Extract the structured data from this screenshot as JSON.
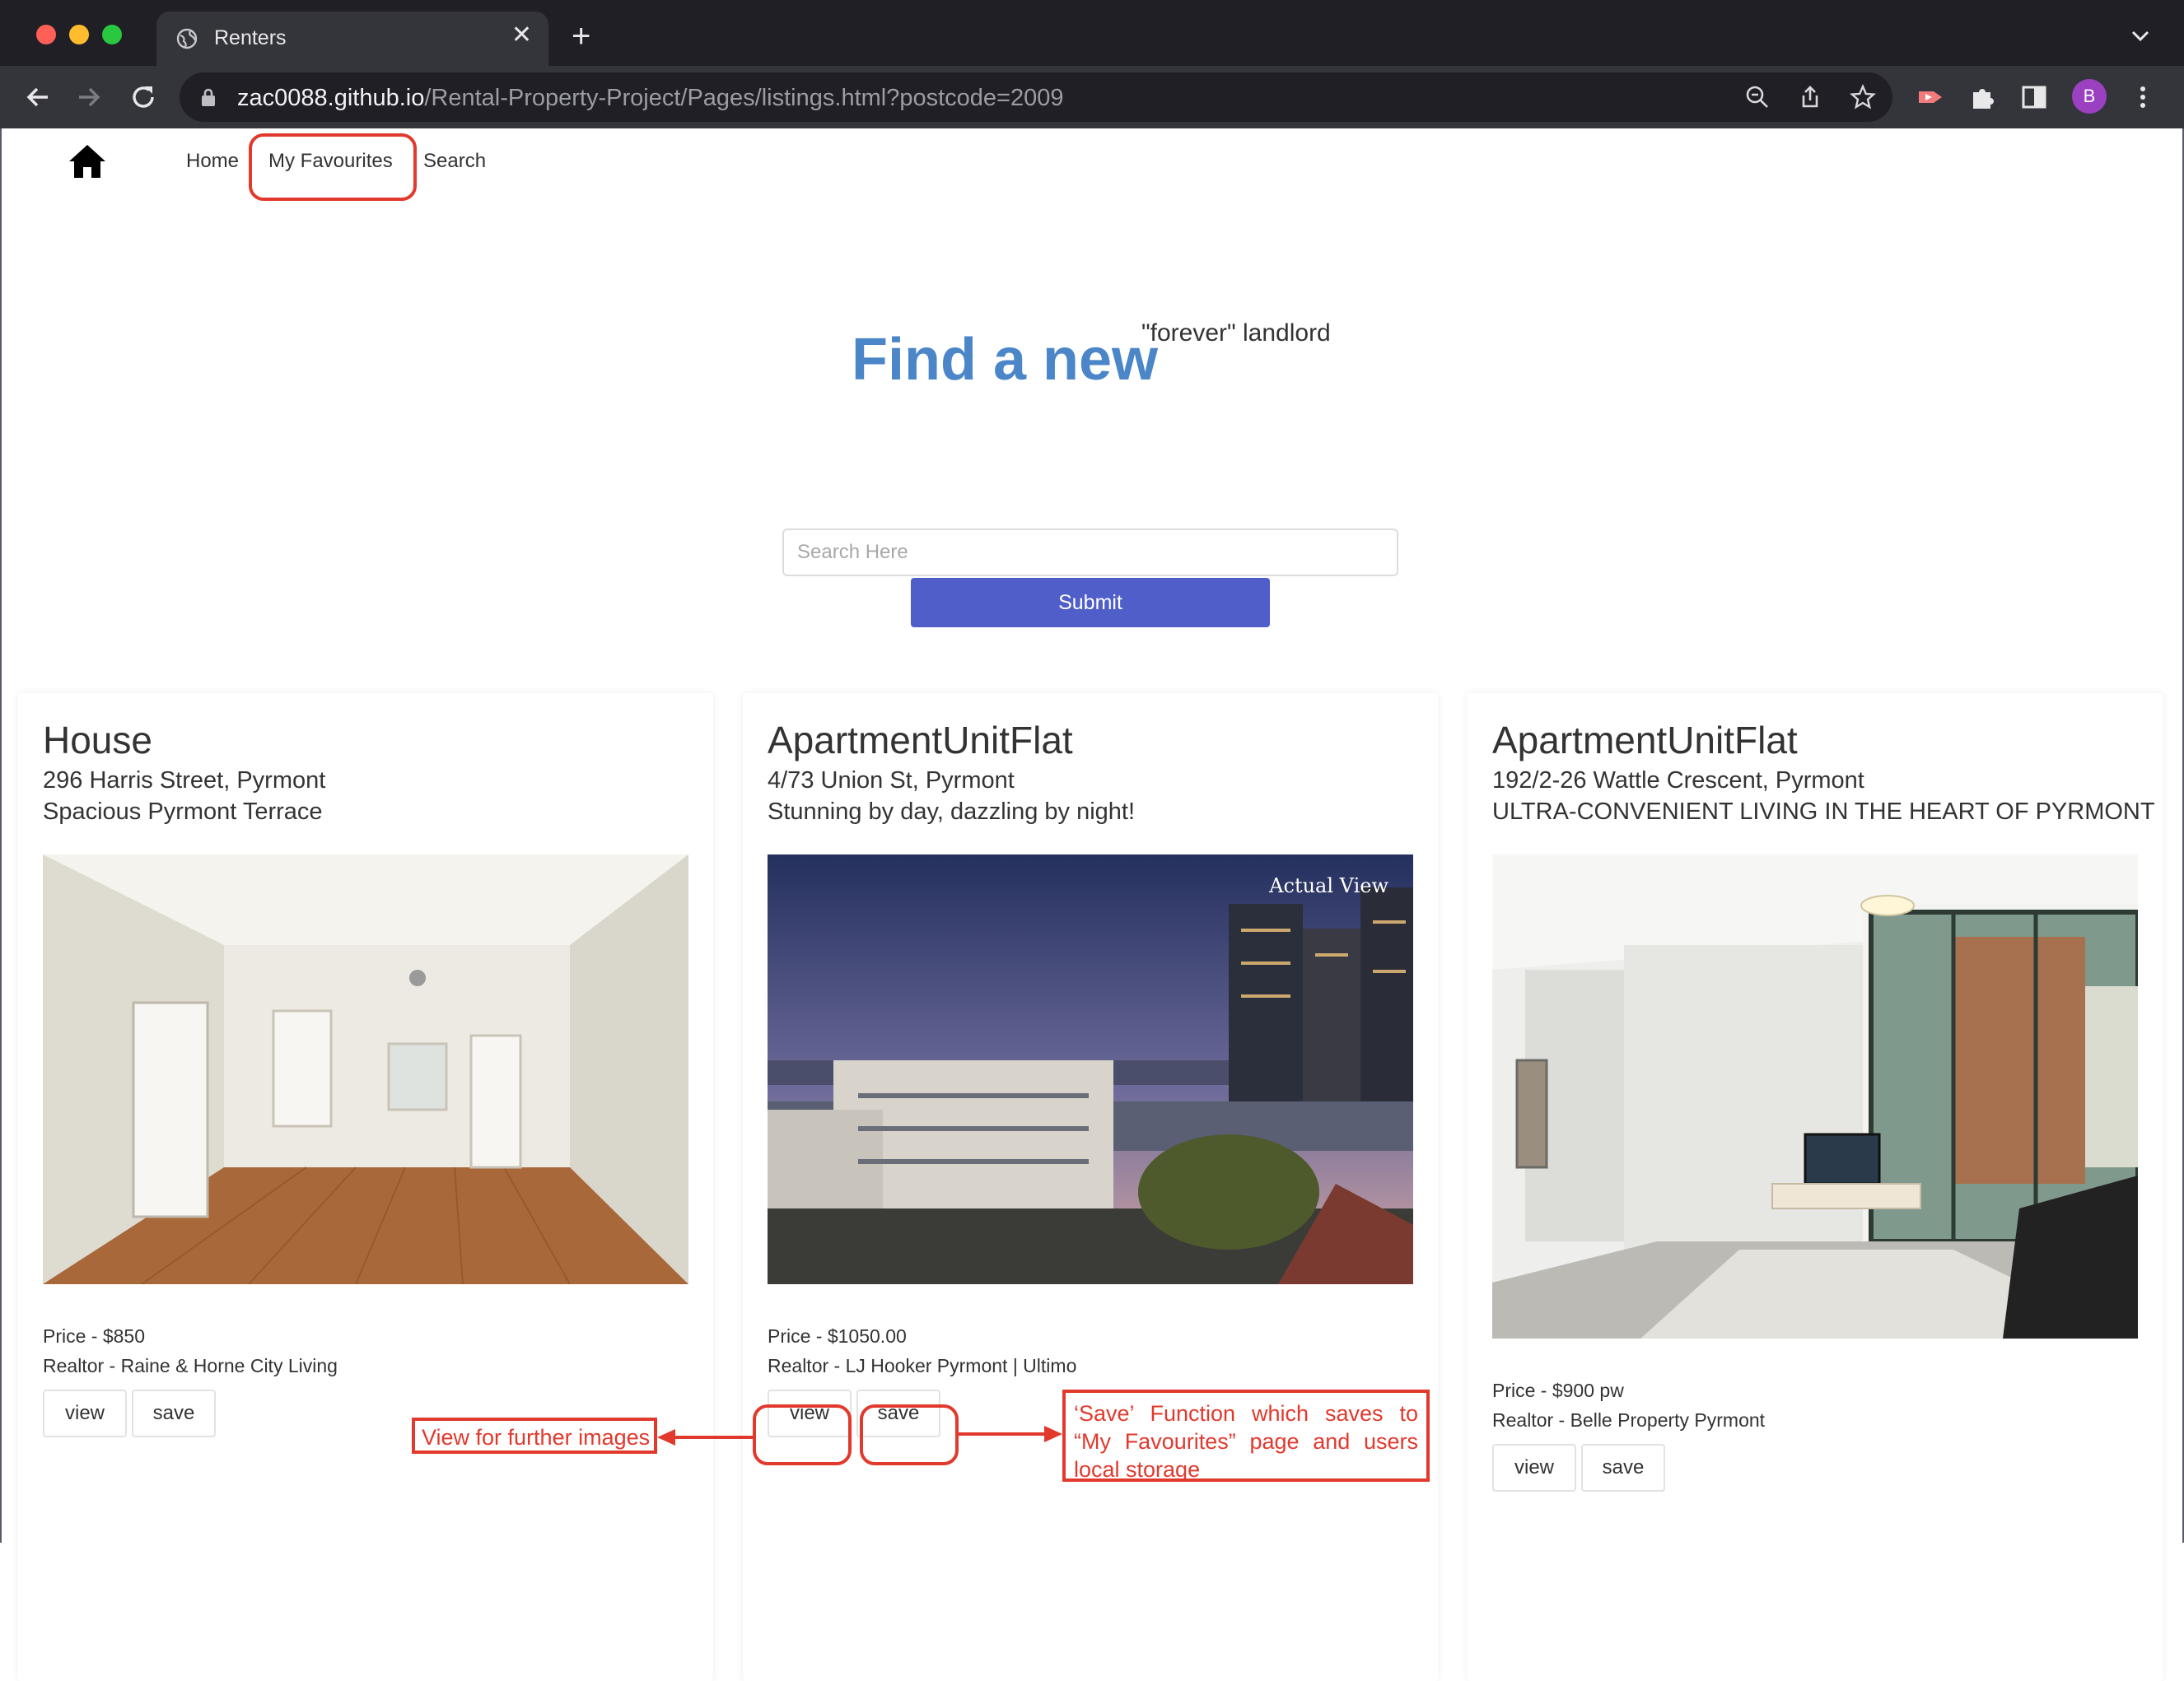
{
  "browser": {
    "tab_title": "Renters",
    "url_host": "zac0088.github.io",
    "url_path": "/Rental-Property-Project/Pages/listings.html?postcode=2009",
    "profile_initial": "B",
    "traffic_lights": [
      "#ff5f57",
      "#febc2e",
      "#28c840"
    ]
  },
  "nav": {
    "items": [
      {
        "label": "Home"
      },
      {
        "label": "My Favourites"
      },
      {
        "label": "Search"
      }
    ]
  },
  "hero": {
    "title": "Find a new",
    "superscript": "\"forever\" landlord"
  },
  "search": {
    "placeholder": "Search Here",
    "value": "",
    "submit_label": "Submit"
  },
  "listings": [
    {
      "type": "House",
      "address": "296 Harris Street, Pyrmont",
      "description": "Spacious Pyrmont Terrace",
      "price": "Price - $850",
      "realtor": "Realtor - Raine & Horne City Living",
      "view_label": "view",
      "save_label": "save",
      "image": "interior-room-photo"
    },
    {
      "type": "ApartmentUnitFlat",
      "address": "4/73 Union St, Pyrmont",
      "description": "Stunning by day, dazzling by night!",
      "price": "Price - $1050.00",
      "realtor": "Realtor - LJ Hooker Pyrmont | Ultimo",
      "view_label": "view",
      "save_label": "save",
      "image_caption": "Actual View",
      "image": "city-view-photo"
    },
    {
      "type": "ApartmentUnitFlat",
      "address": "192/2-26 Wattle Crescent, Pyrmont",
      "description": "ULTRA-CONVENIENT LIVING IN THE HEART OF PYRMONT",
      "price": "Price - $900 pw",
      "realtor": "Realtor - Belle Property Pyrmont",
      "view_label": "view",
      "save_label": "save",
      "image": "living-room-photo"
    }
  ],
  "annotations": {
    "view": "View for further images",
    "save": "‘Save’ Function which saves to “My Favourites” page and users local storage",
    "color": "#e2392d"
  },
  "colors": {
    "hero_title": "#4a86c8",
    "submit_button": "#4f5ec8"
  }
}
